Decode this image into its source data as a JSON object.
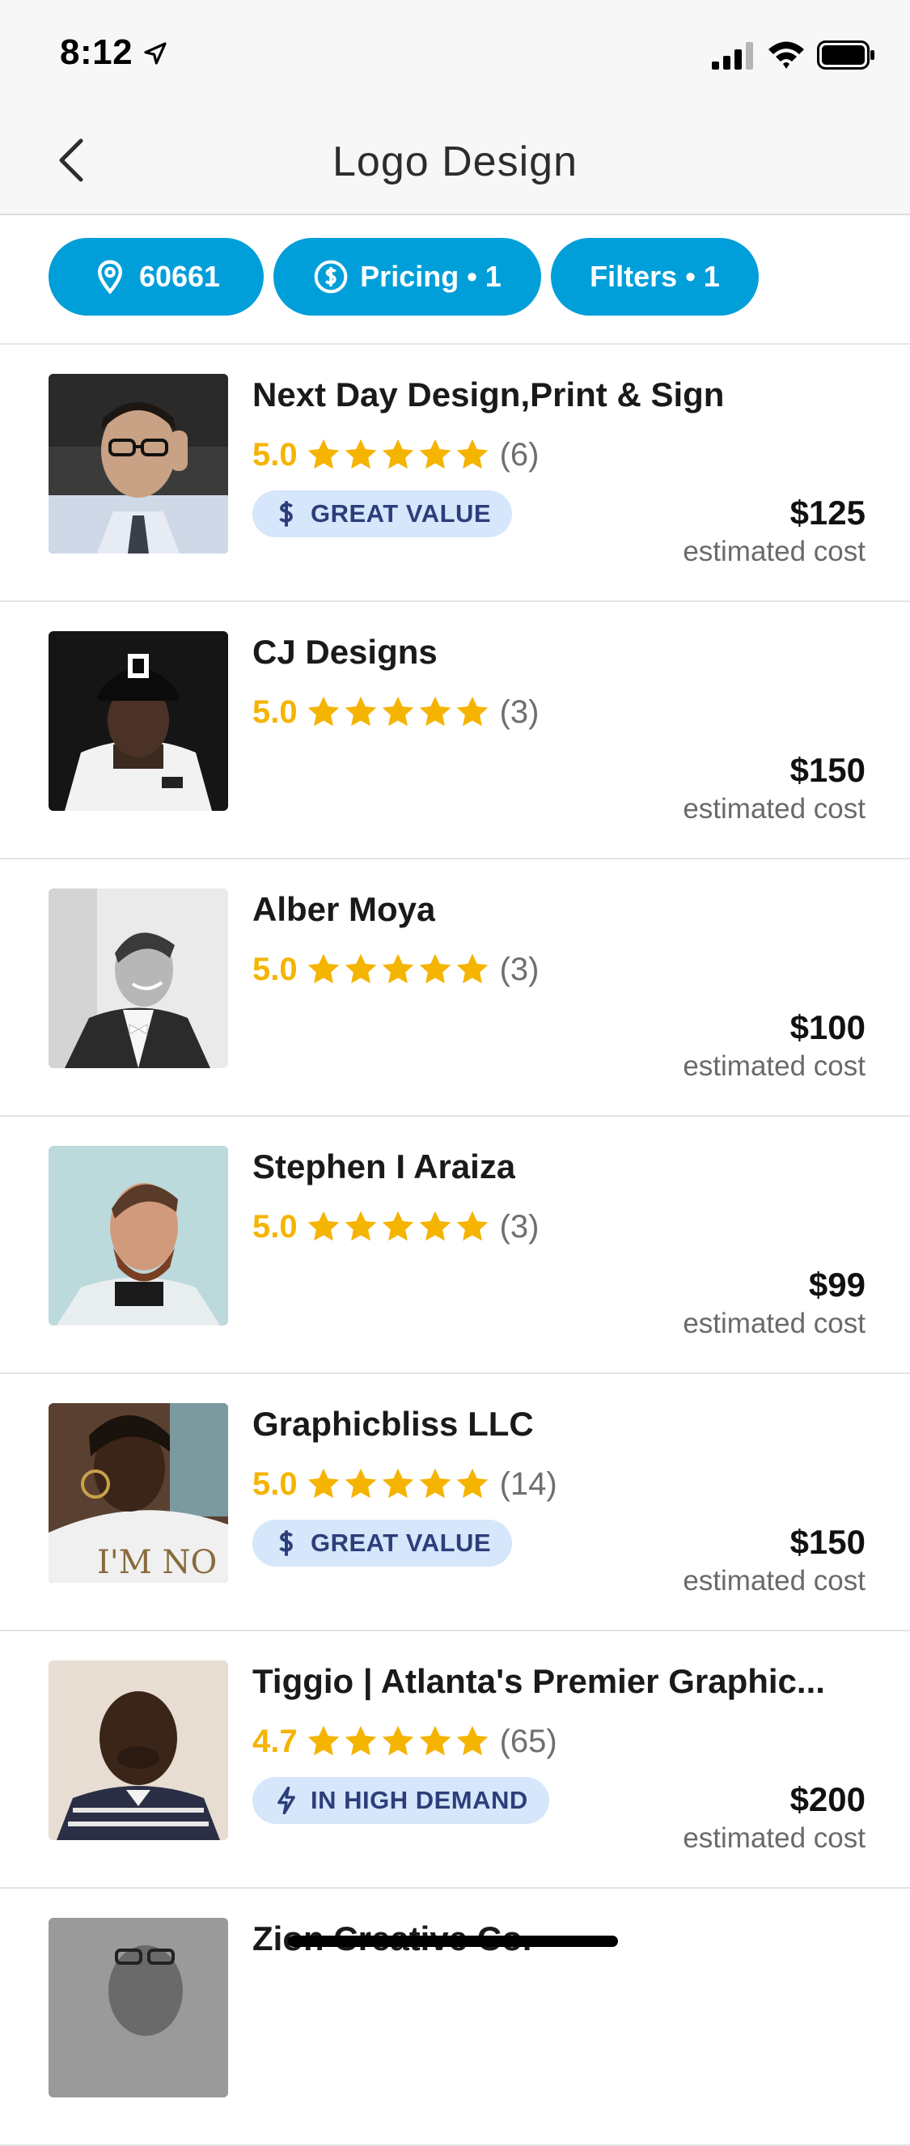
{
  "status_bar": {
    "time": "8:12"
  },
  "nav": {
    "title": "Logo Design"
  },
  "filters": [
    {
      "label": "60661",
      "icon": "location-pin-icon"
    },
    {
      "label": "Pricing • 1",
      "icon": "dollar-circle-icon"
    },
    {
      "label": "Filters • 1",
      "icon": ""
    }
  ],
  "colors": {
    "accent": "#009fd9",
    "star": "#f5b400",
    "badge_bg": "#d6e6fb",
    "badge_text": "#2c3e7a"
  },
  "pros": [
    {
      "name": "Next Day Design,Print & Sign",
      "rating": "5.0",
      "stars": 5,
      "reviews": "(6)",
      "badge": "GREAT VALUE",
      "badge_icon": "dollar-icon",
      "price": "$125",
      "price_label": "estimated cost"
    },
    {
      "name": "CJ Designs",
      "rating": "5.0",
      "stars": 5,
      "reviews": "(3)",
      "badge": "",
      "price": "$150",
      "price_label": "estimated cost"
    },
    {
      "name": "Alber Moya",
      "rating": "5.0",
      "stars": 5,
      "reviews": "(3)",
      "badge": "",
      "price": "$100",
      "price_label": "estimated cost"
    },
    {
      "name": "Stephen I Araiza",
      "rating": "5.0",
      "stars": 5,
      "reviews": "(3)",
      "badge": "",
      "price": "$99",
      "price_label": "estimated cost"
    },
    {
      "name": "Graphicbliss LLC",
      "rating": "5.0",
      "stars": 5,
      "reviews": "(14)",
      "badge": "GREAT VALUE",
      "badge_icon": "dollar-icon",
      "price": "$150",
      "price_label": "estimated cost"
    },
    {
      "name": "Tiggio | Atlanta's Premier Graphic...",
      "rating": "4.7",
      "stars": 4.7,
      "reviews": "(65)",
      "badge": "IN HIGH DEMAND",
      "badge_icon": "lightning-icon",
      "price": "$200",
      "price_label": "estimated cost"
    },
    {
      "name": "Zion Creative Co.",
      "rating": "",
      "stars": 0,
      "reviews": "",
      "badge": "",
      "price": "",
      "price_label": ""
    }
  ]
}
